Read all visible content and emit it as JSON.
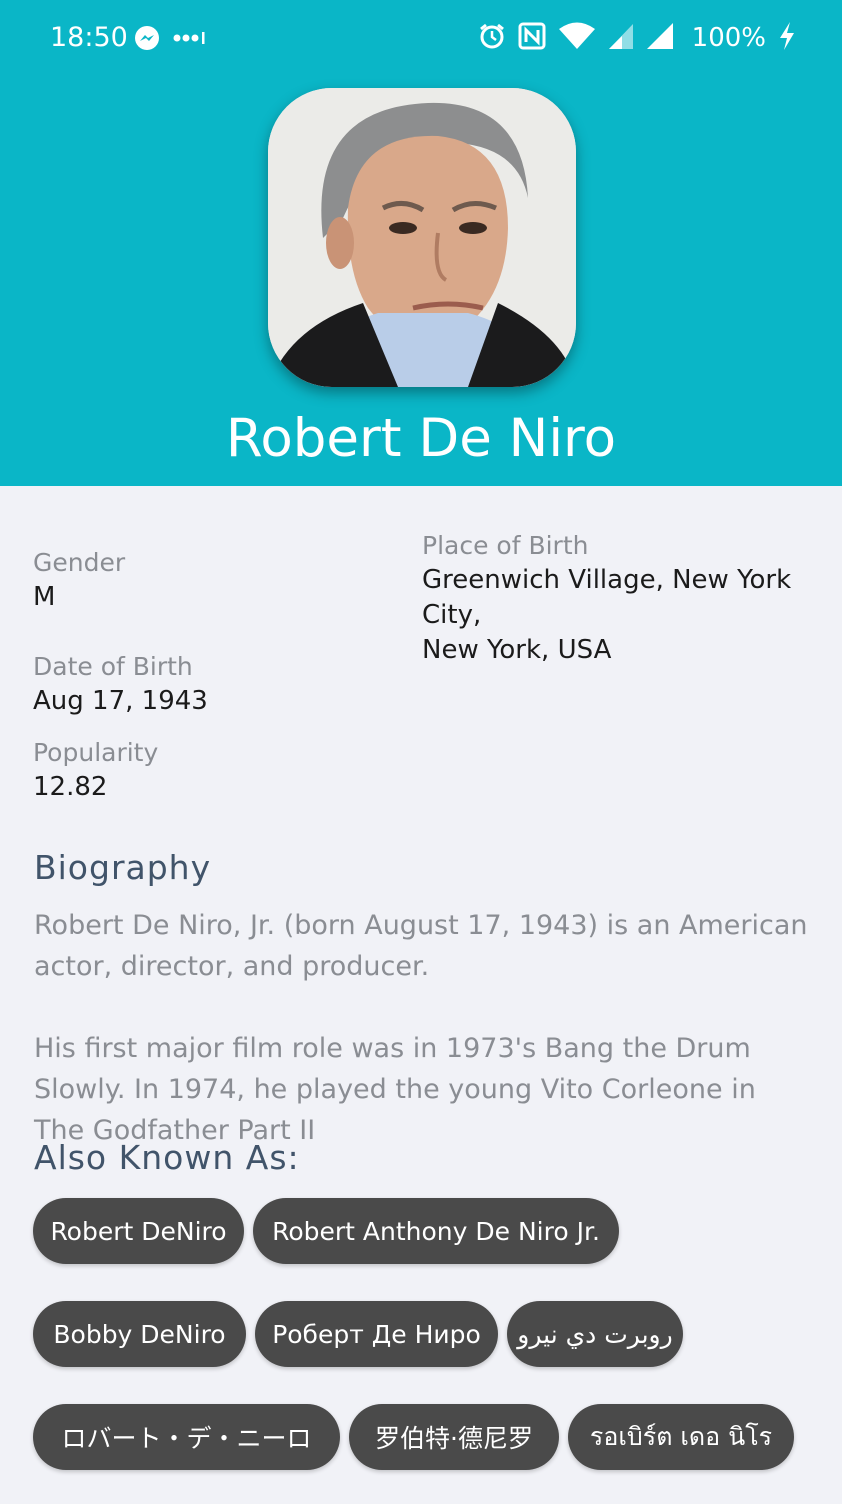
{
  "status_bar": {
    "time": "18:50",
    "battery": "100%",
    "icons": [
      "messenger-icon",
      "more-dots-icon",
      "alarm-icon",
      "nfc-icon",
      "wifi-icon",
      "signal-icon",
      "signal-full-icon",
      "charging-icon"
    ]
  },
  "person": {
    "name": "Robert De Niro",
    "avatar_icon": "profile-photo"
  },
  "details": {
    "gender_label": "Gender",
    "gender": "M",
    "place_label": "Place of Birth",
    "place_line1": "Greenwich Village, New York City,",
    "place_line2": "New York, USA",
    "dob_label": "Date of Birth",
    "dob": "Aug 17, 1943",
    "popularity_label": "Popularity",
    "popularity": "12.82"
  },
  "biography": {
    "title": "Biography",
    "para1_line1": "Robert De Niro, Jr. (born August 17, 1943) is an American",
    "para1_line2": "actor, director, and producer.",
    "para2_line1": "His first major film role was in 1973's Bang the Drum",
    "para2_line2": "Slowly. In 1974, he played the young Vito Corleone in The Godfather Part II"
  },
  "aka": {
    "title": "Also Known As:",
    "names": [
      "Robert DeNiro",
      "Robert Anthony De Niro Jr.",
      "Bobby DeNiro",
      "Роберт Де Ниро",
      "روبرت دي نيرو",
      "ロバート・デ・ニーロ",
      "罗伯特·德尼罗",
      "รอเบิร์ต เดอ นิโร"
    ]
  },
  "colors": {
    "header": "#0ab6c7",
    "background": "#f1f2f7",
    "chip": "#4a4a4a",
    "section_title": "#41546a"
  }
}
